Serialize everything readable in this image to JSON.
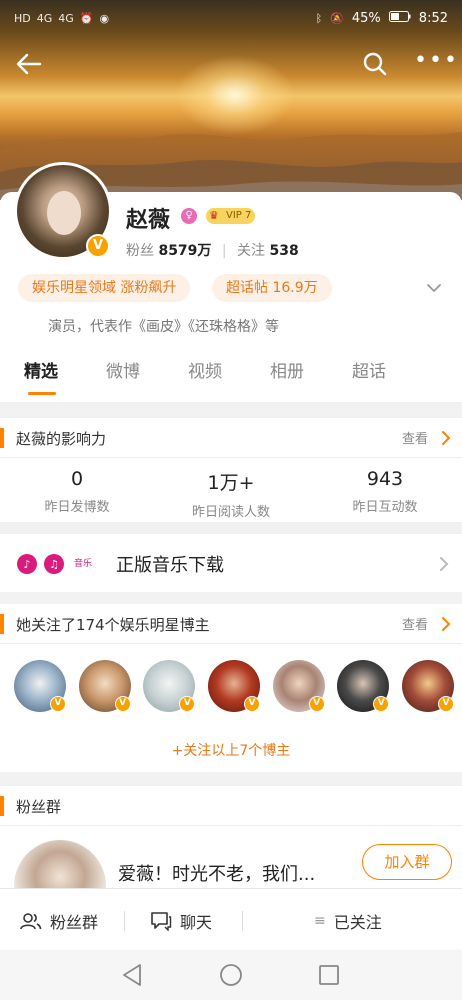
{
  "status_bar": {
    "left_icons": [
      "HD",
      "4G",
      "4G"
    ],
    "battery": "45%",
    "time": "8:52"
  },
  "profile": {
    "name": "赵薇",
    "vip_label": "VIP 7",
    "fans_label": "粉丝",
    "fans_count": "8579万",
    "following_label": "关注",
    "following_count": "538",
    "tags": [
      "娱乐明星领域 涨粉飙升",
      "超话帖 16.9万"
    ],
    "bio": "演员，代表作《画皮》《还珠格格》等"
  },
  "tabs": [
    {
      "label": "精选"
    },
    {
      "label": "微博"
    },
    {
      "label": "视频"
    },
    {
      "label": "相册"
    },
    {
      "label": "超话"
    }
  ],
  "influence": {
    "title": "赵薇的影响力",
    "more_label": "查看",
    "stats": [
      {
        "value": "0",
        "label": "昨日发博数"
      },
      {
        "value": "1万+",
        "label": "昨日阅读人数"
      },
      {
        "value": "943",
        "label": "昨日互动数"
      }
    ]
  },
  "music": {
    "logo_text": "咪咕",
    "logo_sub": "音乐",
    "title": "正版音乐下载"
  },
  "following": {
    "title": "她关注了174个娱乐明星博主",
    "more_label": "查看",
    "follow_more": "+关注以上7个博主"
  },
  "fan_group": {
    "title": "粉丝群",
    "text": "爱薇！时光不老，我们...",
    "join_label": "加入群"
  },
  "bottom_bar": {
    "fans_group": "粉丝群",
    "chat": "聊天",
    "followed": "已关注"
  },
  "colors": {
    "accent": "#ff8200",
    "tag_text": "#e8791a",
    "tag_bg": "#fdf0e6",
    "verified": "#f7a200"
  }
}
